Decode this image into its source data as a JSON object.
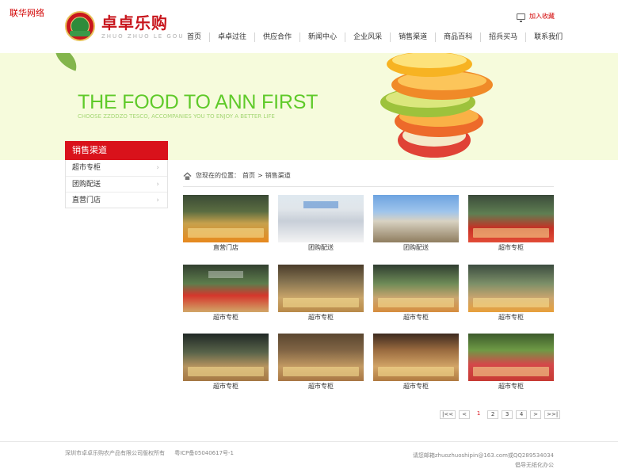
{
  "corner_label": "联华网络",
  "brand": {
    "name_cn": "卓卓乐购",
    "name_pinyin": "ZHUO ZHUO LE GOU"
  },
  "favorite": {
    "label": "加入收藏",
    "icon": "monitor-icon"
  },
  "nav": {
    "items": [
      {
        "label": "首页"
      },
      {
        "label": "卓卓过往"
      },
      {
        "label": "供应合作"
      },
      {
        "label": "新闻中心"
      },
      {
        "label": "企业风采"
      },
      {
        "label": "销售渠道"
      },
      {
        "label": "商品百科"
      },
      {
        "label": "招兵买马"
      },
      {
        "label": "联系我们"
      }
    ]
  },
  "banner": {
    "headline": "THE FOOD TO ANN FIRST",
    "subline": "CHOOSE ZZDDZO TESCO, ACCOMPANIES YOU TO ENJOY A BETTER LIFE"
  },
  "sidebar": {
    "title": "销售渠道",
    "items": [
      {
        "label": "超市专柜"
      },
      {
        "label": "团购配送"
      },
      {
        "label": "直营门店"
      }
    ]
  },
  "breadcrumb": {
    "prefix": "您现在的位置：",
    "home": "首页",
    "separator": ">",
    "current": "销售渠道",
    "icon": "home-icon"
  },
  "gallery": {
    "items": [
      {
        "caption": "直营门店"
      },
      {
        "caption": "团购配送"
      },
      {
        "caption": "团购配送"
      },
      {
        "caption": "超市专柜"
      },
      {
        "caption": "超市专柜"
      },
      {
        "caption": "超市专柜"
      },
      {
        "caption": "超市专柜"
      },
      {
        "caption": "超市专柜"
      },
      {
        "caption": "超市专柜"
      },
      {
        "caption": "超市专柜"
      },
      {
        "caption": "超市专柜"
      },
      {
        "caption": "超市专柜"
      }
    ]
  },
  "pagination": {
    "first": "|<<",
    "prev": "<",
    "pages": [
      "1",
      "2",
      "3",
      "4"
    ],
    "current_page": "1",
    "next": ">",
    "last": ">>|"
  },
  "footer": {
    "copyright": "深圳市卓卓乐购农产品有限公司版权所有",
    "icp": "粤ICP备05040617号-1",
    "contact": "请您邮箱zhuozhuoshipin@163.com或QQ289534034",
    "note": "倡导无纸化办公"
  },
  "colors": {
    "accent_red": "#d9121b",
    "banner_green": "#5fca2a",
    "banner_bg": "#f6fbdc"
  }
}
